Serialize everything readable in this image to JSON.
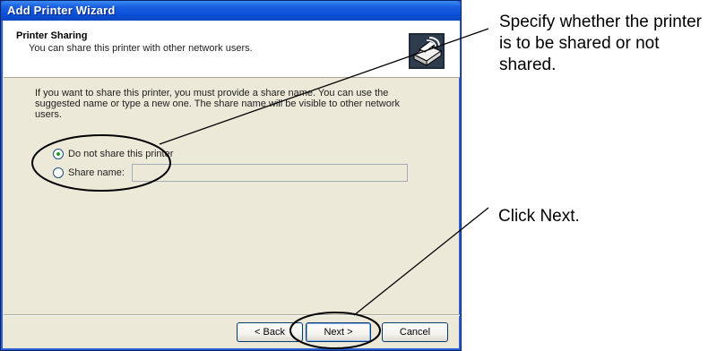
{
  "window": {
    "title": "Add Printer Wizard"
  },
  "header": {
    "title": "Printer Sharing",
    "subtitle": "You can share this printer with other network users.",
    "icon": "printer-sharing-icon"
  },
  "body": {
    "intro_text": "If you want to share this printer, you must provide a share name. You can use the suggested name or type a new one. The share name will be visible to other network users."
  },
  "sharing_options": {
    "do_not_share_label": "Do not share this printer",
    "do_not_share_selected": true,
    "share_name_label": "Share name:",
    "share_name_selected": false,
    "share_name_value": ""
  },
  "buttons": {
    "back_label": "< Back",
    "next_label": "Next >",
    "cancel_label": "Cancel"
  },
  "annotations": {
    "share_callout": "Specify whether the printer is to be shared or not shared.",
    "next_callout": "Click Next."
  },
  "colors": {
    "titlebar": "#0a46c2",
    "dialog_face": "#ece9d8",
    "radio_selected": "#21a121"
  }
}
